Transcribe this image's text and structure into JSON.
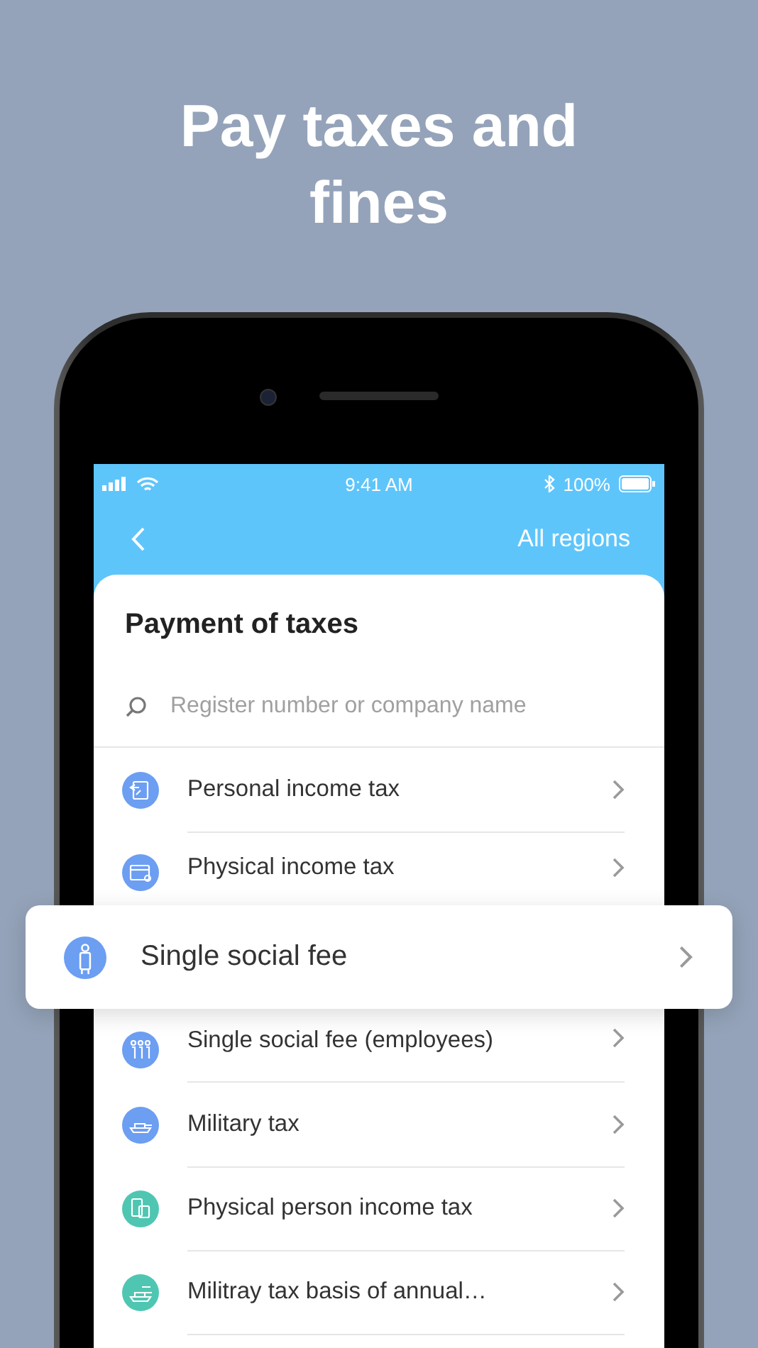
{
  "headline": "Pay taxes and fines",
  "status_bar": {
    "time": "9:41 AM",
    "battery": "100%"
  },
  "nav": {
    "action": "All regions"
  },
  "card": {
    "title": "Payment of taxes",
    "search": {
      "placeholder": "Register number or company name"
    }
  },
  "items": [
    {
      "label": "Personal income tax",
      "color": "#6c9ef2",
      "highlighted": false
    },
    {
      "label": "Physical income tax",
      "color": "#6c9ef2",
      "highlighted": false
    },
    {
      "label": "Single social fee",
      "color": "#6c9ef2",
      "highlighted": true
    },
    {
      "label": "Single social fee (employees)",
      "color": "#6c9ef2",
      "highlighted": false
    },
    {
      "label": "Military tax",
      "color": "#6c9ef2",
      "highlighted": false
    },
    {
      "label": "Physical person income tax",
      "color": "#4fc6b2",
      "highlighted": false
    },
    {
      "label": "Militray tax basis of annual…",
      "color": "#4fc6b2",
      "highlighted": false
    }
  ]
}
